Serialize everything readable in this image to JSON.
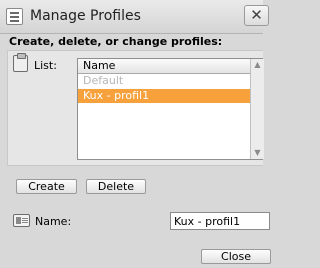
{
  "window": {
    "title": "Manage Profiles",
    "close_symbol": "✕"
  },
  "heading": "Create, delete, or change profiles:",
  "list": {
    "label": "List:",
    "column_header": "Name",
    "rows": [
      {
        "label": "Default",
        "state": "disabled"
      },
      {
        "label": "Kux - profil1",
        "state": "selected"
      }
    ],
    "scroll_up_symbol": "▲",
    "scroll_down_symbol": "▼"
  },
  "buttons": {
    "create": "Create",
    "delete": "Delete",
    "close": "Close"
  },
  "name_field": {
    "label": "Name:",
    "value": "Kux - profil1"
  },
  "colors": {
    "selection": "#f7a13d",
    "background": "#d8d8d8"
  },
  "icons": {
    "window": "profile-list-icon",
    "list": "clipboard-icon",
    "name": "name-card-icon"
  }
}
